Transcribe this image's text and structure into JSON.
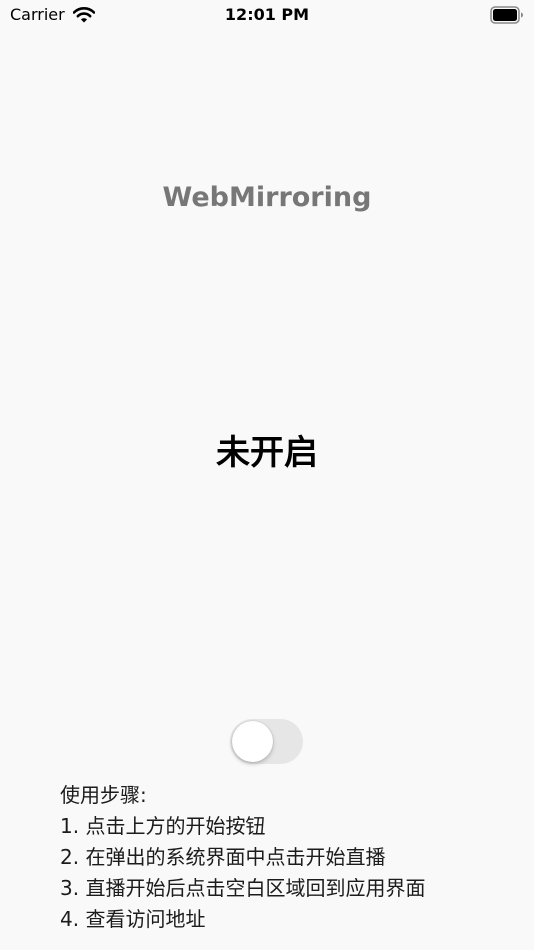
{
  "status_bar": {
    "carrier": "Carrier",
    "time": "12:01 PM",
    "wifi_icon": "wifi-icon",
    "battery_icon": "battery-icon"
  },
  "app_title": "WebMirroring",
  "status_text": "未开启",
  "toggle": {
    "state": "off",
    "on": false
  },
  "instructions": {
    "heading": "使用步骤:",
    "steps": [
      "1. 点击上方的开始按钮",
      "2. 在弹出的系统界面中点击开始直播",
      "3. 直播开始后点击空白区域回到应用界面",
      "4. 查看访问地址"
    ]
  },
  "colors": {
    "background": "#f9f9f9",
    "title": "#777777",
    "text": "#000000",
    "toggle_track_off": "#e6e6e6",
    "toggle_knob": "#ffffff"
  }
}
